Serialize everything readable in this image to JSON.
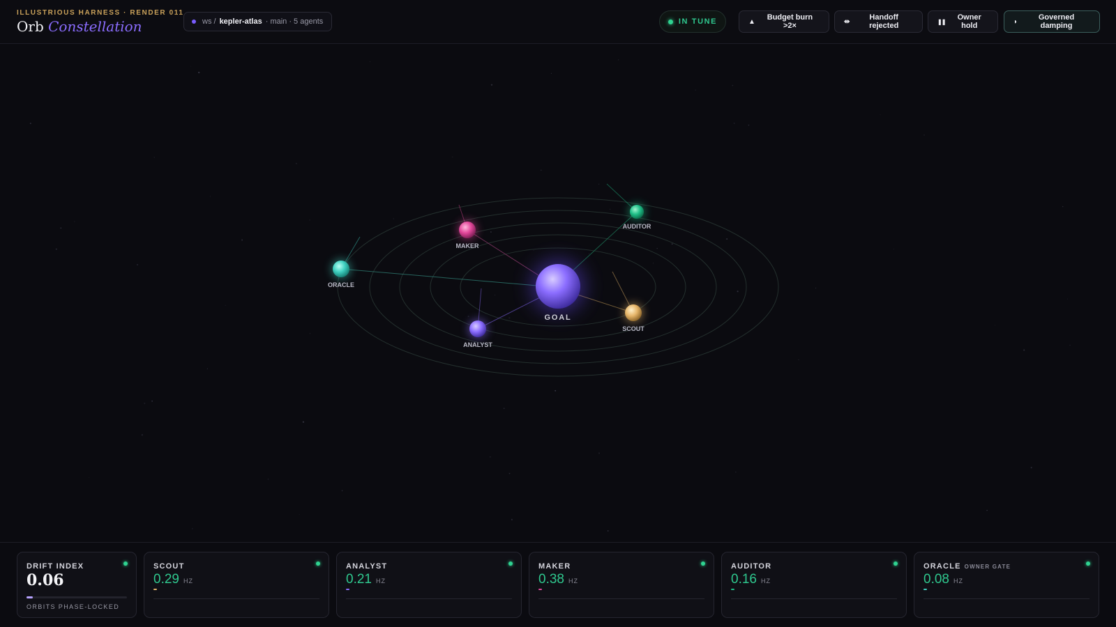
{
  "header": {
    "eyebrow": "ILLUSTRIOUS HARNESS · RENDER 011",
    "title_plain": "Orb",
    "title_accent": "Constellation"
  },
  "workspace": {
    "prefix": "ws /",
    "name": "kepler-atlas",
    "details": "· main · 5 agents"
  },
  "status": {
    "label": "IN TUNE",
    "color": "#2fd391"
  },
  "actions": [
    {
      "label": "Budget burn >2×",
      "icon": "warning-triangle-icon",
      "glyph": "▲"
    },
    {
      "label": "Handoff rejected",
      "icon": "handoff-arrows-icon",
      "glyph": "⇹"
    },
    {
      "label": "Owner hold",
      "icon": "pause-icon",
      "glyph": "❚❚"
    },
    {
      "label": "Governed damping",
      "icon": "half-moon-icon",
      "glyph": "◗"
    }
  ],
  "constellation": {
    "goal": {
      "label": "GOAL",
      "color": "#8b6dff"
    },
    "agents": [
      {
        "id": "oracle",
        "label": "ORACLE",
        "color": "#3fd0c0"
      },
      {
        "id": "maker",
        "label": "MAKER",
        "color": "#e2479a"
      },
      {
        "id": "auditor",
        "label": "AUDITOR",
        "color": "#1fbf88"
      },
      {
        "id": "analyst",
        "label": "ANALYST",
        "color": "#8b6dff"
      },
      {
        "id": "scout",
        "label": "SCOUT",
        "color": "#e6b56a"
      }
    ]
  },
  "metrics": {
    "drift": {
      "title": "DRIFT INDEX",
      "value": "0.06",
      "caption": "ORBITS PHASE-LOCKED",
      "fraction": 0.06
    },
    "agents": [
      {
        "title": "SCOUT",
        "tag": "",
        "value": "0.29",
        "unit": "HZ",
        "accent": "#e6b56a"
      },
      {
        "title": "ANALYST",
        "tag": "",
        "value": "0.21",
        "unit": "HZ",
        "accent": "#8b6dff"
      },
      {
        "title": "MAKER",
        "tag": "",
        "value": "0.38",
        "unit": "HZ",
        "accent": "#e2479a"
      },
      {
        "title": "AUDITOR",
        "tag": "",
        "value": "0.16",
        "unit": "HZ",
        "accent": "#1fbf88"
      },
      {
        "title": "ORACLE",
        "tag": "OWNER GATE",
        "value": "0.08",
        "unit": "HZ",
        "accent": "#3fd0c0"
      }
    ]
  }
}
